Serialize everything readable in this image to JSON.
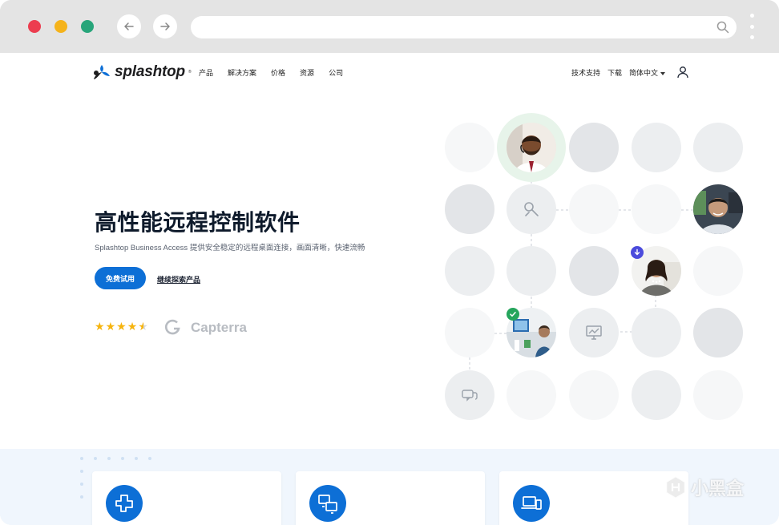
{
  "browser": {
    "back_icon": "arrow-left-icon",
    "forward_icon": "arrow-right-icon",
    "search_icon": "search-icon",
    "menu_icon": "kebab-menu-icon",
    "traffic_colors": [
      "#ec3d4f",
      "#f5b31b",
      "#27a57a"
    ]
  },
  "header": {
    "logo_text": "splashtop",
    "logo_tm": "®",
    "nav": [
      "产品",
      "解决方案",
      "价格",
      "资源",
      "公司"
    ],
    "right_nav": {
      "support": "技术支持",
      "download": "下载",
      "language": "简体中文"
    }
  },
  "hero": {
    "title": "高性能远程控制软件",
    "subtitle": "Splashtop Business Access 提供安全稳定的远程桌面连接，画面清晰，快速流畅",
    "cta_primary": "免费试用",
    "cta_secondary": "继续探索产品",
    "rating": 4.5,
    "review_logo": "Capterra",
    "accent": "#0d6fd6"
  },
  "watermark": {
    "text": "小黑盒"
  }
}
